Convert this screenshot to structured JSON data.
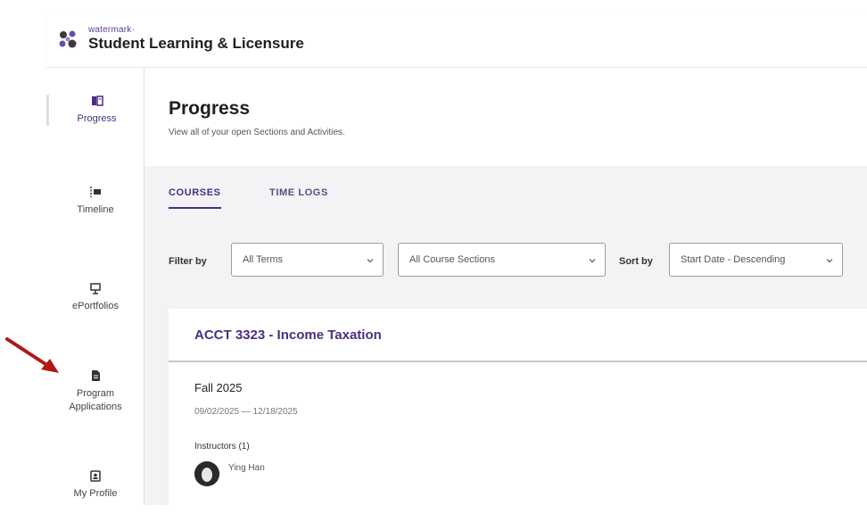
{
  "header": {
    "brand_small": "watermark·",
    "app_title": "Student Learning & Licensure"
  },
  "sidebar": {
    "items": [
      {
        "label": "Progress",
        "icon": "progress-icon"
      },
      {
        "label": "Timeline",
        "icon": "timeline-icon"
      },
      {
        "label": "ePortfolios",
        "icon": "eportfolio-icon"
      },
      {
        "label_line1": "Program",
        "label_line2": "Applications",
        "icon": "document-icon"
      },
      {
        "label": "My Profile",
        "icon": "profile-icon"
      }
    ]
  },
  "page": {
    "title": "Progress",
    "subtitle": "View all of your open Sections and Activities."
  },
  "tabs": [
    {
      "label": "COURSES"
    },
    {
      "label": "TIME LOGS"
    }
  ],
  "filters": {
    "filter_by_label": "Filter by",
    "terms_value": "All Terms",
    "sections_value": "All Course Sections",
    "sort_by_label": "Sort by",
    "sort_value": "Start Date - Descending"
  },
  "course": {
    "title": "ACCT 3323 - Income Taxation",
    "term": "Fall 2025",
    "dates": "09/02/2025 — 12/18/2025",
    "instructors_label": "Instructors (1)",
    "instructor_name": "Ying Han"
  },
  "colors": {
    "accent": "#4b2e83",
    "annotation_arrow": "#b01818"
  }
}
